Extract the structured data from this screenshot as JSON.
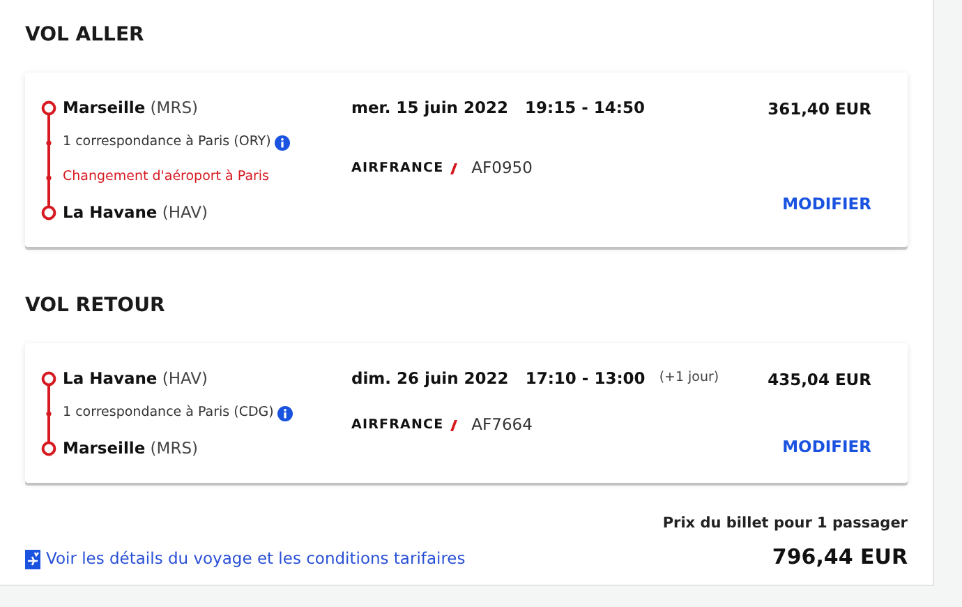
{
  "legs": [
    {
      "heading": "VOL ALLER",
      "stops": [
        {
          "kind": "city",
          "city": "Marseille",
          "code": "(MRS)"
        },
        {
          "kind": "connection",
          "text": "1 correspondance à Paris (ORY)"
        },
        {
          "kind": "airport_change",
          "text": "Changement d'aéroport à Paris"
        },
        {
          "kind": "city",
          "city": "La Havane",
          "code": "(HAV)"
        }
      ],
      "date": "mer. 15 juin 2022",
      "times": "19:15 - 14:50",
      "airline": "AIRFRANCE",
      "flight": "AF0950",
      "price": "361,40 EUR",
      "action": "MODIFIER"
    },
    {
      "heading": "VOL RETOUR",
      "stops": [
        {
          "kind": "city",
          "city": "La Havane",
          "code": "(HAV)"
        },
        {
          "kind": "connection",
          "text": "1 correspondance à Paris (CDG)"
        },
        {
          "kind": "city",
          "city": "Marseille",
          "code": "(MRS)"
        }
      ],
      "date": "dim. 26 juin 2022",
      "times": "17:10 - 13:00",
      "day_offset": "(+1 jour)",
      "airline": "AIRFRANCE",
      "flight": "AF7664",
      "price": "435,04 EUR",
      "action": "MODIFIER"
    }
  ],
  "footer": {
    "link": "Voir les détails du voyage et les conditions tarifaires",
    "price_label": "Prix du billet pour 1 passager",
    "total": "796,44 EUR"
  }
}
